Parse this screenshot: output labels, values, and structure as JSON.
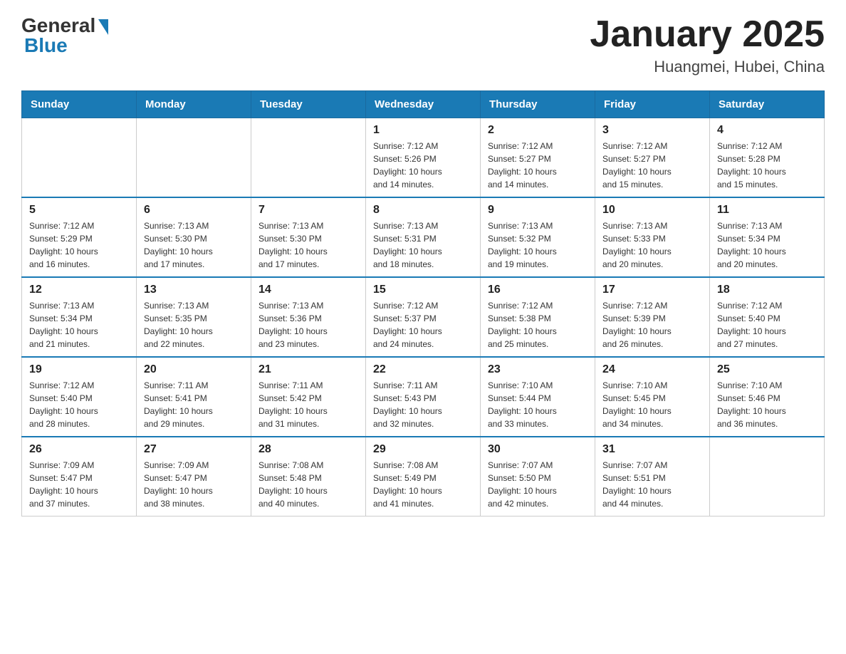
{
  "header": {
    "logo_general": "General",
    "logo_blue": "Blue",
    "title": "January 2025",
    "subtitle": "Huangmei, Hubei, China"
  },
  "days_of_week": [
    "Sunday",
    "Monday",
    "Tuesday",
    "Wednesday",
    "Thursday",
    "Friday",
    "Saturday"
  ],
  "weeks": [
    [
      {
        "day": "",
        "info": ""
      },
      {
        "day": "",
        "info": ""
      },
      {
        "day": "",
        "info": ""
      },
      {
        "day": "1",
        "info": "Sunrise: 7:12 AM\nSunset: 5:26 PM\nDaylight: 10 hours\nand 14 minutes."
      },
      {
        "day": "2",
        "info": "Sunrise: 7:12 AM\nSunset: 5:27 PM\nDaylight: 10 hours\nand 14 minutes."
      },
      {
        "day": "3",
        "info": "Sunrise: 7:12 AM\nSunset: 5:27 PM\nDaylight: 10 hours\nand 15 minutes."
      },
      {
        "day": "4",
        "info": "Sunrise: 7:12 AM\nSunset: 5:28 PM\nDaylight: 10 hours\nand 15 minutes."
      }
    ],
    [
      {
        "day": "5",
        "info": "Sunrise: 7:12 AM\nSunset: 5:29 PM\nDaylight: 10 hours\nand 16 minutes."
      },
      {
        "day": "6",
        "info": "Sunrise: 7:13 AM\nSunset: 5:30 PM\nDaylight: 10 hours\nand 17 minutes."
      },
      {
        "day": "7",
        "info": "Sunrise: 7:13 AM\nSunset: 5:30 PM\nDaylight: 10 hours\nand 17 minutes."
      },
      {
        "day": "8",
        "info": "Sunrise: 7:13 AM\nSunset: 5:31 PM\nDaylight: 10 hours\nand 18 minutes."
      },
      {
        "day": "9",
        "info": "Sunrise: 7:13 AM\nSunset: 5:32 PM\nDaylight: 10 hours\nand 19 minutes."
      },
      {
        "day": "10",
        "info": "Sunrise: 7:13 AM\nSunset: 5:33 PM\nDaylight: 10 hours\nand 20 minutes."
      },
      {
        "day": "11",
        "info": "Sunrise: 7:13 AM\nSunset: 5:34 PM\nDaylight: 10 hours\nand 20 minutes."
      }
    ],
    [
      {
        "day": "12",
        "info": "Sunrise: 7:13 AM\nSunset: 5:34 PM\nDaylight: 10 hours\nand 21 minutes."
      },
      {
        "day": "13",
        "info": "Sunrise: 7:13 AM\nSunset: 5:35 PM\nDaylight: 10 hours\nand 22 minutes."
      },
      {
        "day": "14",
        "info": "Sunrise: 7:13 AM\nSunset: 5:36 PM\nDaylight: 10 hours\nand 23 minutes."
      },
      {
        "day": "15",
        "info": "Sunrise: 7:12 AM\nSunset: 5:37 PM\nDaylight: 10 hours\nand 24 minutes."
      },
      {
        "day": "16",
        "info": "Sunrise: 7:12 AM\nSunset: 5:38 PM\nDaylight: 10 hours\nand 25 minutes."
      },
      {
        "day": "17",
        "info": "Sunrise: 7:12 AM\nSunset: 5:39 PM\nDaylight: 10 hours\nand 26 minutes."
      },
      {
        "day": "18",
        "info": "Sunrise: 7:12 AM\nSunset: 5:40 PM\nDaylight: 10 hours\nand 27 minutes."
      }
    ],
    [
      {
        "day": "19",
        "info": "Sunrise: 7:12 AM\nSunset: 5:40 PM\nDaylight: 10 hours\nand 28 minutes."
      },
      {
        "day": "20",
        "info": "Sunrise: 7:11 AM\nSunset: 5:41 PM\nDaylight: 10 hours\nand 29 minutes."
      },
      {
        "day": "21",
        "info": "Sunrise: 7:11 AM\nSunset: 5:42 PM\nDaylight: 10 hours\nand 31 minutes."
      },
      {
        "day": "22",
        "info": "Sunrise: 7:11 AM\nSunset: 5:43 PM\nDaylight: 10 hours\nand 32 minutes."
      },
      {
        "day": "23",
        "info": "Sunrise: 7:10 AM\nSunset: 5:44 PM\nDaylight: 10 hours\nand 33 minutes."
      },
      {
        "day": "24",
        "info": "Sunrise: 7:10 AM\nSunset: 5:45 PM\nDaylight: 10 hours\nand 34 minutes."
      },
      {
        "day": "25",
        "info": "Sunrise: 7:10 AM\nSunset: 5:46 PM\nDaylight: 10 hours\nand 36 minutes."
      }
    ],
    [
      {
        "day": "26",
        "info": "Sunrise: 7:09 AM\nSunset: 5:47 PM\nDaylight: 10 hours\nand 37 minutes."
      },
      {
        "day": "27",
        "info": "Sunrise: 7:09 AM\nSunset: 5:47 PM\nDaylight: 10 hours\nand 38 minutes."
      },
      {
        "day": "28",
        "info": "Sunrise: 7:08 AM\nSunset: 5:48 PM\nDaylight: 10 hours\nand 40 minutes."
      },
      {
        "day": "29",
        "info": "Sunrise: 7:08 AM\nSunset: 5:49 PM\nDaylight: 10 hours\nand 41 minutes."
      },
      {
        "day": "30",
        "info": "Sunrise: 7:07 AM\nSunset: 5:50 PM\nDaylight: 10 hours\nand 42 minutes."
      },
      {
        "day": "31",
        "info": "Sunrise: 7:07 AM\nSunset: 5:51 PM\nDaylight: 10 hours\nand 44 minutes."
      },
      {
        "day": "",
        "info": ""
      }
    ]
  ]
}
